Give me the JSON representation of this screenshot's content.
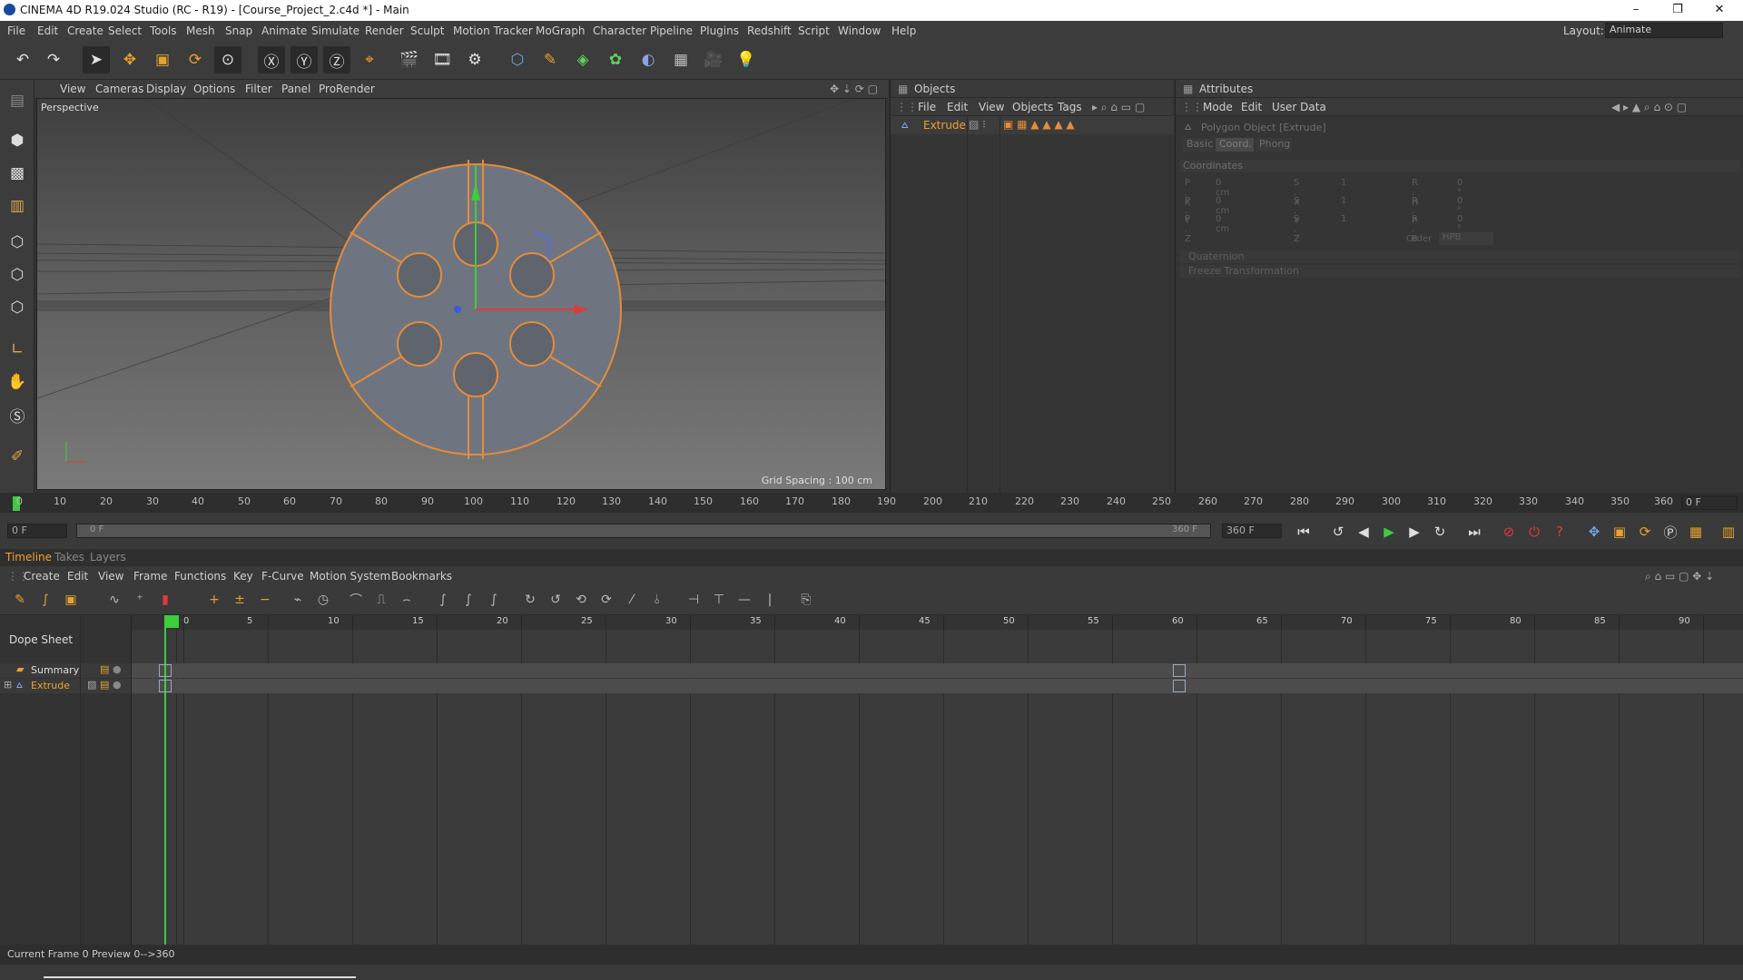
{
  "window": {
    "title": "CINEMA 4D R19.024 Studio (RC - R19) - [Course_Project_2.c4d *] - Main",
    "min": "–",
    "max": "❐",
    "close": "✕"
  },
  "menubar": {
    "items": [
      "File",
      "Edit",
      "Create",
      "Select",
      "Tools",
      "Mesh",
      "Snap",
      "Animate",
      "Simulate",
      "Render",
      "Sculpt",
      "Motion Tracker",
      "MoGraph",
      "Character",
      "Pipeline",
      "Plugins",
      "Redshift",
      "Script",
      "Window",
      "Help"
    ],
    "layout_label": "Layout:",
    "layout_value": "Animate"
  },
  "viewport": {
    "menu": [
      "View",
      "Cameras",
      "Display",
      "Options",
      "Filter",
      "Panel",
      "ProRender"
    ],
    "camera_label": "Perspective",
    "grid_spacing": "Grid Spacing : 100 cm"
  },
  "objects_panel": {
    "title": "Objects",
    "menu": [
      "File",
      "Edit",
      "View",
      "Objects",
      "Tags"
    ],
    "object_name": "Extrude"
  },
  "attributes_panel": {
    "title": "Attributes",
    "menu": [
      "Mode",
      "Edit",
      "User Data"
    ],
    "object_label": "Polygon Object [Extrude]",
    "tabs": [
      "Basic",
      "Coord.",
      "Phong"
    ],
    "section": "Coordinates",
    "rows": [
      {
        "p": "P . X",
        "pv": "0 cm",
        "s": "S . X",
        "sv": "1",
        "r": "R . H",
        "rv": "0 °"
      },
      {
        "p": "P . Y",
        "pv": "0 cm",
        "s": "S . Y",
        "sv": "1",
        "r": "R . P",
        "rv": "0 °"
      },
      {
        "p": "P . Z",
        "pv": "0 cm",
        "s": "S . Z",
        "sv": "1",
        "r": "R . B",
        "rv": "0 °"
      }
    ],
    "order_label": "Order",
    "order_value": "HPB",
    "collapsed": [
      "Quaternion",
      "Freeze Transformation"
    ]
  },
  "main_ruler": {
    "ticks": [
      "0",
      "10",
      "20",
      "30",
      "40",
      "50",
      "60",
      "70",
      "80",
      "90",
      "100",
      "110",
      "120",
      "130",
      "140",
      "150",
      "160",
      "170",
      "180",
      "190",
      "200",
      "210",
      "220",
      "230",
      "240",
      "250",
      "260",
      "270",
      "280",
      "290",
      "300",
      "310",
      "320",
      "330",
      "340",
      "350",
      "360"
    ],
    "current_field": "0 F"
  },
  "range": {
    "start": "0 F",
    "slider_start": "0 F",
    "slider_end": "360 F",
    "end": "360 F"
  },
  "tabs": [
    "Timeline",
    "Takes",
    "Layers"
  ],
  "timeline_menu": [
    "Create",
    "Edit",
    "View",
    "Frame",
    "Functions",
    "Key",
    "F-Curve",
    "Motion System",
    "Bookmarks"
  ],
  "dope_sheet": {
    "title": "Dope Sheet",
    "rows": [
      "Summary",
      "Extrude"
    ],
    "ticks": [
      "0",
      "5",
      "10",
      "15",
      "20",
      "25",
      "30",
      "35",
      "40",
      "45",
      "50",
      "55",
      "60",
      "65",
      "70",
      "75",
      "80",
      "85",
      "90"
    ]
  },
  "status": "Current Frame  0  Preview  0-->360",
  "colors": {
    "accent": "#e58c3a",
    "green": "#3ecb3e",
    "selected_text": "#f0a030"
  }
}
